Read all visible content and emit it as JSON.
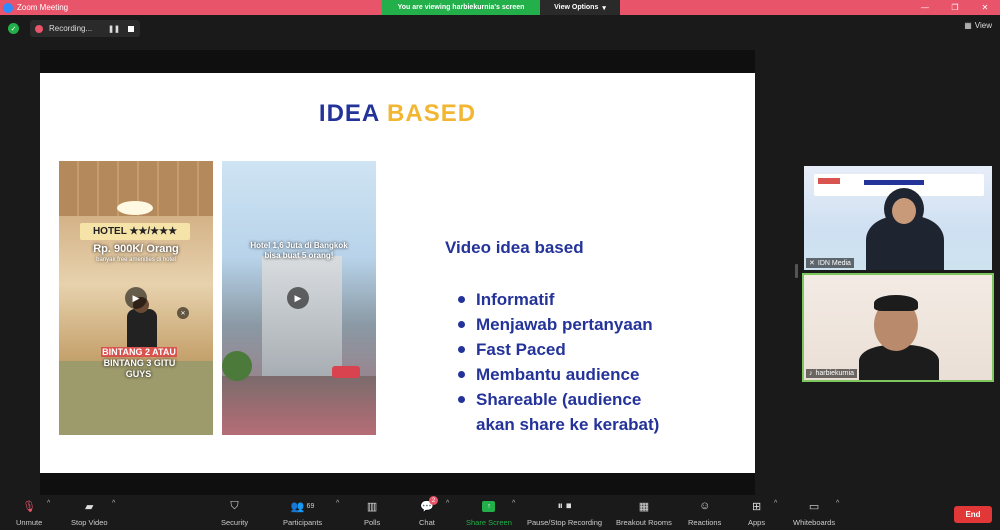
{
  "window": {
    "title": "Zoom Meeting",
    "viewing_banner": "You are viewing harbiekurnia's screen",
    "view_options_label": "View Options",
    "view_button_label": "View"
  },
  "recording": {
    "label": "Recording..."
  },
  "slide": {
    "title_part1": "IDEA",
    "title_part2": "BASED",
    "subtitle": "Video idea based",
    "bullets": [
      "Informatif",
      "Menjawab pertanyaan",
      "Fast Paced",
      "Membantu audience",
      "Shareable (audience"
    ],
    "bullet_continuation": "akan share ke kerabat)",
    "thumb1": {
      "hotel_label": "HOTEL ★★/★★★",
      "price": "Rp. 900K/ Orang",
      "amenities": "banyak free amenities di hotel",
      "caption_part1": "BINTANG 2 ATAU",
      "caption_part2": "BINTANG 3 GITU GUYS"
    },
    "thumb2": {
      "caption_line1": "Hotel 1,6 Juta di Bangkok",
      "caption_line2": "bisa buat 5 orang!"
    }
  },
  "participants": [
    {
      "name": "IDN Media"
    },
    {
      "name": "harbiekurnia"
    }
  ],
  "toolbar": {
    "unmute": "Unmute",
    "stop_video": "Stop Video",
    "security": "Security",
    "participants": "Participants",
    "participants_count": "69",
    "polls": "Polls",
    "chat": "Chat",
    "chat_badge": "2",
    "share_screen": "Share Screen",
    "pause_recording": "Pause/Stop Recording",
    "breakout_rooms": "Breakout Rooms",
    "reactions": "Reactions",
    "apps": "Apps",
    "whiteboards": "Whiteboards",
    "end": "End"
  },
  "colors": {
    "title_bar": "#e8546a",
    "banner_green": "#23b04a",
    "slide_blue": "#24339a",
    "slide_yellow": "#f2b632",
    "end_red": "#e23737"
  }
}
